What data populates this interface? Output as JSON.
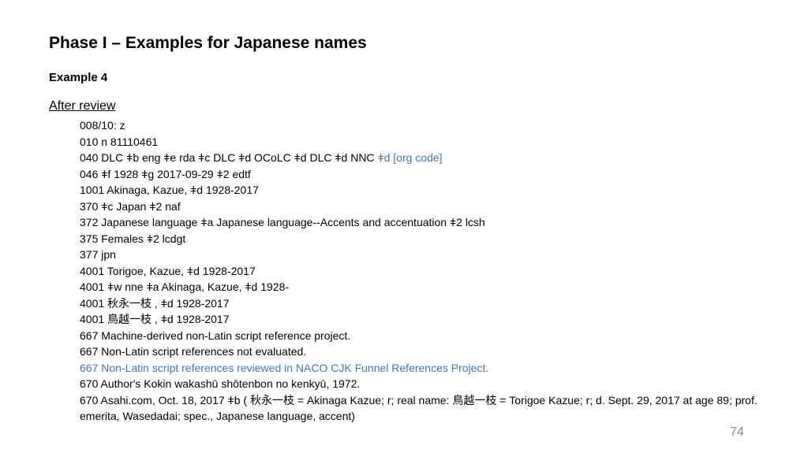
{
  "slide": {
    "title": "Phase I – Examples for Japanese names",
    "subtitle": "Example 4",
    "section_label": "After review",
    "page_number": "74",
    "colors": {
      "accent_blue": "#4472c4",
      "page_number_gray": "#8c8c8c"
    }
  },
  "record": {
    "line_008": "008/10: z",
    "line_010": "010  n  81110461",
    "line_040_main": "040  DLC ǂb eng ǂe rda ǂc DLC ǂd OCoLC ǂd DLC ǂd NNC ",
    "line_040_added": "ǂd [org code]",
    "line_046": "046  ǂf 1928 ǂg 2017-09-29 ǂ2 edtf",
    "line_1001": "1001 Akinaga, Kazue, ǂd 1928-2017",
    "line_370": "370  ǂc Japan ǂ2 naf",
    "line_372": "372  Japanese language ǂa Japanese language--Accents and accentuation ǂ2 lcsh",
    "line_375": "375  Females ǂ2 lcdgt",
    "line_377": "377  jpn",
    "line_4001_a": "4001 Torigoe, Kazue, ǂd 1928-2017",
    "line_4001_b": "4001 ǂw nne ǂa Akinaga, Kazue, ǂd 1928-",
    "line_4001_c": "4001  秋永一枝 , ǂd 1928-2017",
    "line_4001_d": "4001  鳥越一枝 , ǂd 1928-2017",
    "line_667_a": "667  Machine-derived non-Latin script reference project.",
    "line_667_b": "667  Non-Latin script references not evaluated.",
    "line_667_c": "667  Non-Latin script references reviewed in NACO CJK Funnel References Project.",
    "line_670_a": "670  Author's Kokin wakashū shōtenbon no kenkyū, 1972.",
    "line_670_b": "670  Asahi.com, Oct. 18, 2017 ǂb ( 秋永一枝  = Akinaga Kazue; r; real name:  鳥越一枝  = Torigoe Kazue; r; d. Sept. 29, 2017 at age 89; prof. emerita, Wasedadai; spec., Japanese language, accent)"
  }
}
